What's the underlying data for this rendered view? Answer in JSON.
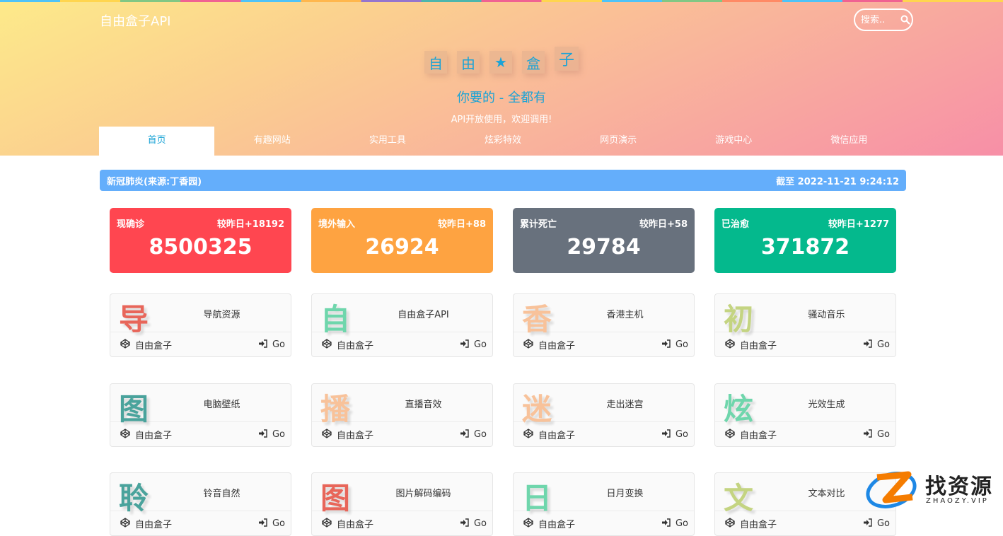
{
  "header": {
    "brand": "自由盒子API",
    "search_placeholder": "搜索..",
    "title_chars": [
      "自",
      "由",
      "★",
      "盒",
      "子"
    ],
    "slogan": "你要的 - 全都有",
    "subslogan": "API开放使用，欢迎调用!"
  },
  "tabs": [
    {
      "label": "首页",
      "active": true
    },
    {
      "label": "有趣网站",
      "active": false
    },
    {
      "label": "实用工具",
      "active": false
    },
    {
      "label": "炫彩特效",
      "active": false
    },
    {
      "label": "网页演示",
      "active": false
    },
    {
      "label": "游戏中心",
      "active": false
    },
    {
      "label": "微信应用",
      "active": false
    }
  ],
  "infobar": {
    "title": "新冠肺炎(来源:丁香园)",
    "updated": "截至 2022-11-21 9:24:12"
  },
  "stats": [
    {
      "label": "现确诊",
      "delta": "较昨日+18192",
      "value": "8500325",
      "color": "#ff4650"
    },
    {
      "label": "境外输入",
      "delta": "较昨日+88",
      "value": "26924",
      "color": "#fea341"
    },
    {
      "label": "累计死亡",
      "delta": "较昨日+58",
      "value": "29784",
      "color": "#68717d"
    },
    {
      "label": "已治愈",
      "delta": "较昨日+1277",
      "value": "371872",
      "color": "#04b98d"
    }
  ],
  "cards": [
    {
      "glyph": "导",
      "name": "导航资源",
      "source": "自由盒子",
      "go": "Go",
      "color": "#e8665a"
    },
    {
      "glyph": "自",
      "name": "自由盒子API",
      "source": "自由盒子",
      "go": "Go",
      "color": "#6fd6ac"
    },
    {
      "glyph": "香",
      "name": "香港主机",
      "source": "自由盒子",
      "go": "Go",
      "color": "#f8c29a"
    },
    {
      "glyph": "初",
      "name": "骚动音乐",
      "source": "自由盒子",
      "go": "Go",
      "color": "#c4d481"
    },
    {
      "glyph": "图",
      "name": "电脑壁纸",
      "source": "自由盒子",
      "go": "Go",
      "color": "#4aa39c"
    },
    {
      "glyph": "播",
      "name": "直播音效",
      "source": "自由盒子",
      "go": "Go",
      "color": "#f8c29a"
    },
    {
      "glyph": "迷",
      "name": "走出迷宫",
      "source": "自由盒子",
      "go": "Go",
      "color": "#f8c29a"
    },
    {
      "glyph": "炫",
      "name": "光效生成",
      "source": "自由盒子",
      "go": "Go",
      "color": "#6fd6ac"
    },
    {
      "glyph": "聆",
      "name": "铃音自然",
      "source": "自由盒子",
      "go": "Go",
      "color": "#4aa39c"
    },
    {
      "glyph": "图",
      "name": "图片解码编码",
      "source": "自由盒子",
      "go": "Go",
      "color": "#e8665a"
    },
    {
      "glyph": "日",
      "name": "日月变换",
      "source": "自由盒子",
      "go": "Go",
      "color": "#6fd6ac"
    },
    {
      "glyph": "文",
      "name": "文本对比",
      "source": "自由盒子",
      "go": "Go",
      "color": "#c4d481"
    }
  ],
  "watermark": {
    "cn": "找资源",
    "en": "ZHAOZY.VIP"
  }
}
